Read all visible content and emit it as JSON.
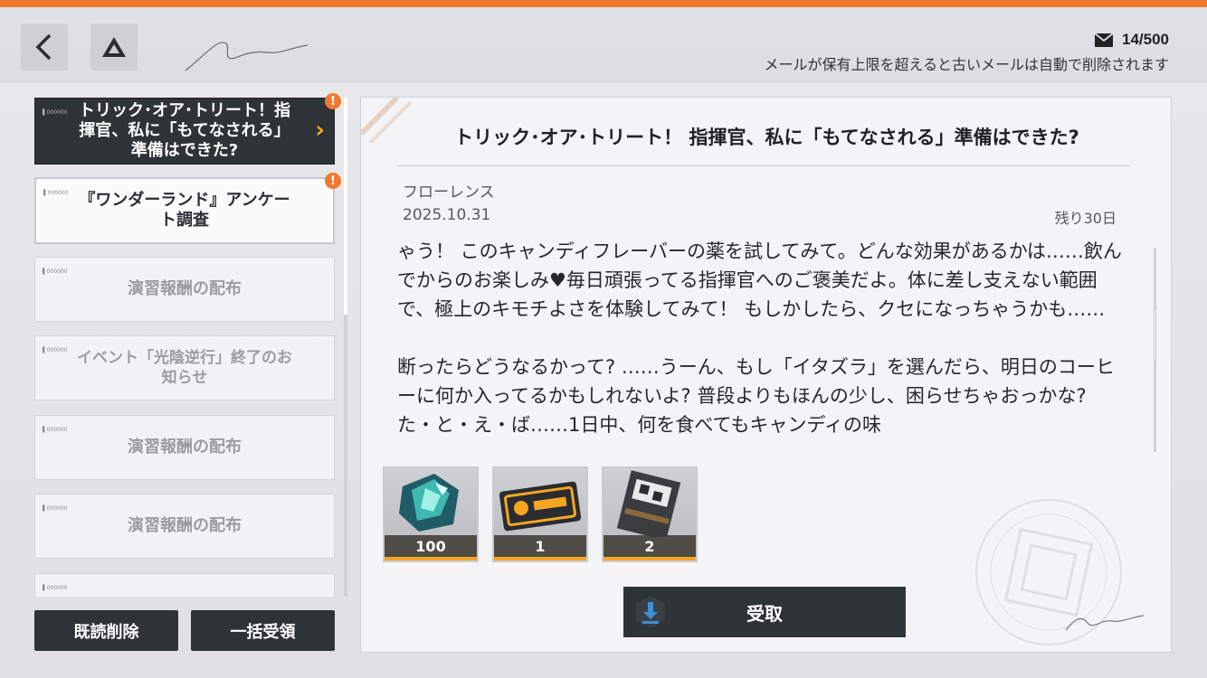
{
  "header": {
    "back_icon": "chevron-left-icon",
    "drive_icon": "triangle-logo-icon",
    "mail_icon": "envelope-icon",
    "mail_count": "14/500",
    "notice": "メールが保有上限を超えると古いメールは自動で削除されます"
  },
  "mail_list": {
    "items": [
      {
        "title": "トリック･オア･トリート！指揮官、私に「もてなされる」準備はできた?",
        "state": "selected",
        "badge": "!"
      },
      {
        "title": "『ワンダーランド』アンケート調査",
        "state": "unread",
        "badge": "!"
      },
      {
        "title": "演習報酬の配布",
        "state": "read"
      },
      {
        "title": "イベント「光陰逆行」終了のお知らせ",
        "state": "read"
      },
      {
        "title": "演習報酬の配布",
        "state": "read"
      },
      {
        "title": "演習報酬の配布",
        "state": "read"
      }
    ]
  },
  "actions": {
    "delete_read": "既読削除",
    "claim_all": "一括受領"
  },
  "detail": {
    "title": "トリック･オア･トリート！ 指揮官、私に「もてなされる」準備はできた?",
    "sender": "フローレンス",
    "date": "2025.10.31",
    "remaining": "残り30日",
    "body_p1": "ゃう！ このキャンディフレーバーの薬を試してみて。どんな効果があるかは……飲んでからのお楽しみ♥毎日頑張ってる指揮官へのご褒美だよ。体に差し支えない範囲で、極上のキモチよさを体験してみて！ もしかしたら、クセになっちゃうかも……",
    "body_p2": "断ったらどうなるかって? ……うーん、もし「イタズラ」を選んだら、明日のコーヒーに何か入ってるかもしれないよ? 普段よりもほんの少し、困らせちゃおっかな? た・と・え・ば……1日中、何を食べてもキャンディの味",
    "rewards": [
      {
        "icon": "gem-crystal-icon",
        "quantity": "100"
      },
      {
        "icon": "ticket-card-icon",
        "quantity": "1"
      },
      {
        "icon": "package-box-icon",
        "quantity": "2"
      }
    ],
    "claim_label": "受取",
    "claim_icon": "download-icon"
  },
  "colors": {
    "accent": "#ee7a2f",
    "highlight": "#f5a623",
    "dark_button": "#2e3338",
    "claim_icon_bg": "#3a8fd6"
  }
}
